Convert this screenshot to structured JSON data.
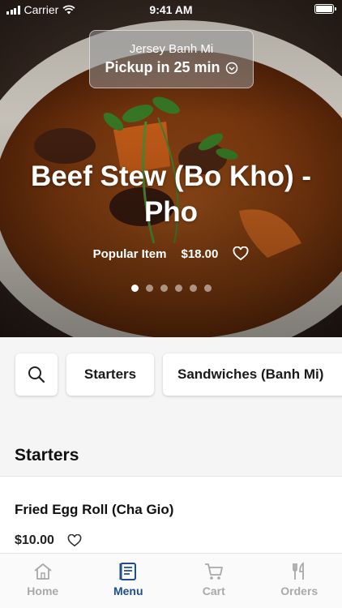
{
  "status_bar": {
    "carrier": "Carrier",
    "time": "9:41 AM"
  },
  "pickup": {
    "store": "Jersey Banh Mi",
    "eta": "Pickup in 25 min"
  },
  "hero": {
    "title": "Beef Stew (Bo Kho) - Pho",
    "badge": "Popular Item",
    "price": "$18.00",
    "carousel": {
      "count": 6,
      "active_index": 0
    }
  },
  "categories": {
    "search_icon": "search-icon",
    "items": [
      "Starters",
      "Sandwiches (Banh Mi)"
    ]
  },
  "section": {
    "title": "Starters"
  },
  "menu_items": [
    {
      "name": "Fried Egg Roll (Cha Gio)",
      "price": "$10.00"
    }
  ],
  "tabbar": {
    "tabs": [
      {
        "label": "Home",
        "icon": "home-icon",
        "active": false
      },
      {
        "label": "Menu",
        "icon": "menu-icon",
        "active": true
      },
      {
        "label": "Cart",
        "icon": "cart-icon",
        "active": false
      },
      {
        "label": "Orders",
        "icon": "utensils-icon",
        "active": false
      }
    ],
    "active_color": "#1f4e8c",
    "inactive_color": "#a9a9a9"
  }
}
